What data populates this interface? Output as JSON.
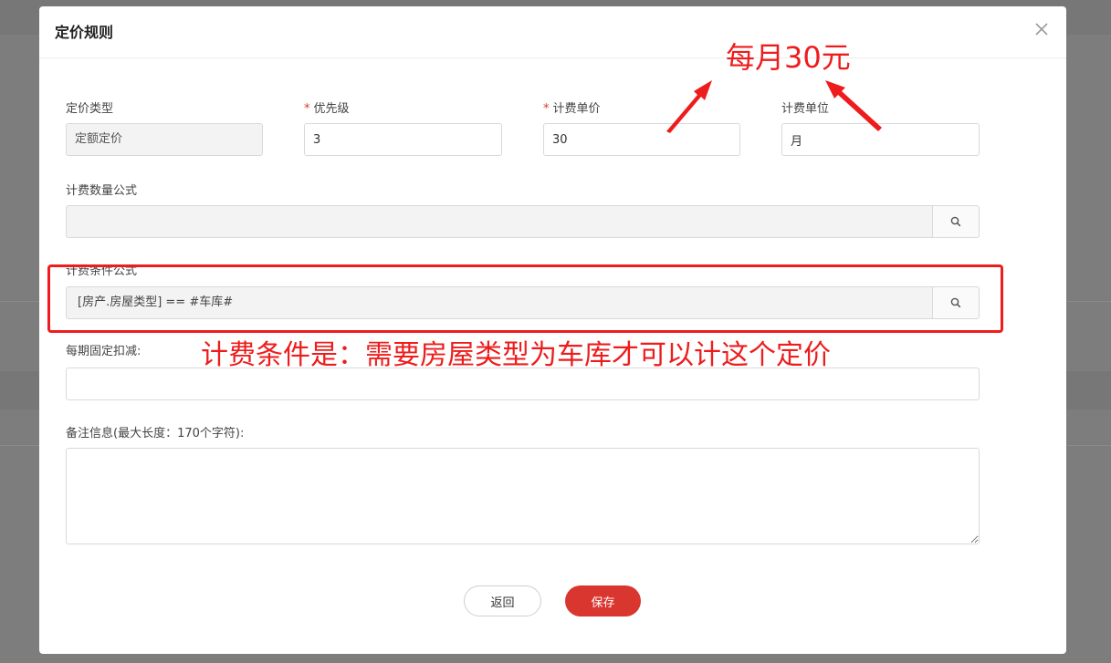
{
  "dialog": {
    "title": "定价规则"
  },
  "form": {
    "pricing_type": {
      "label": "定价类型",
      "value": "定额定价"
    },
    "priority": {
      "required_mark": "*",
      "label": "优先级",
      "value": "3"
    },
    "unit_price": {
      "required_mark": "*",
      "label": "计费单价",
      "value": "30"
    },
    "billing_unit": {
      "label": "计费单位",
      "value": "月"
    },
    "quantity_formula": {
      "label": "计费数量公式",
      "value": ""
    },
    "condition_formula": {
      "label": "计费条件公式",
      "value": "[房产.房屋类型] == #车库#"
    },
    "fixed_deduction": {
      "label": "每期固定扣减:",
      "value": ""
    },
    "remarks": {
      "label": "备注信息(最大长度：170个字符):",
      "value": ""
    }
  },
  "buttons": {
    "back": "返回",
    "save": "保存"
  },
  "annotations": {
    "monthly_note": "每月30元",
    "condition_note": "计费条件是：需要房屋类型为车库才可以计这个定价",
    "color": "#ee1c1c"
  },
  "icons": {
    "close": "close-icon",
    "search": "search-icon"
  }
}
